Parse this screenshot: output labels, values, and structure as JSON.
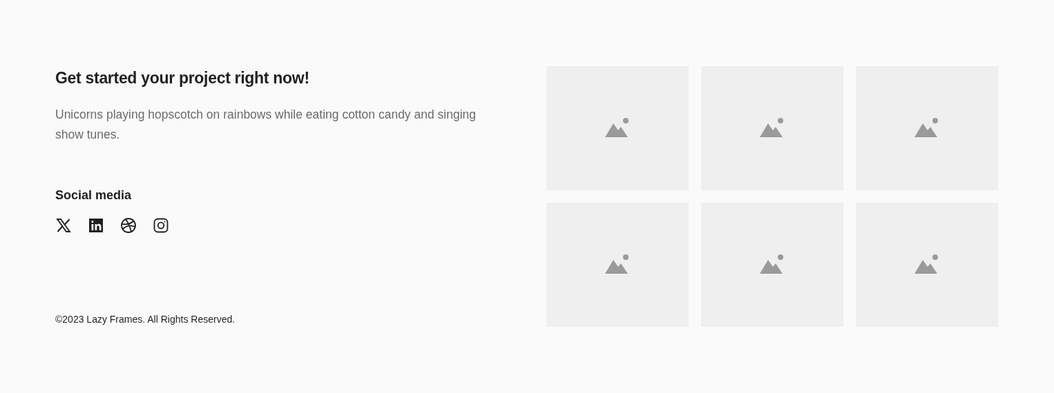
{
  "heading": "Get started your project right now!",
  "description": "Unicorns playing hopscotch on rainbows while eating cotton candy and singing show tunes.",
  "social": {
    "title": "Social media",
    "links": [
      {
        "kind": "x"
      },
      {
        "kind": "linkedin"
      },
      {
        "kind": "dribbble"
      },
      {
        "kind": "instagram"
      }
    ]
  },
  "copyright": "©2023 Lazy Frames. All Rights Reserved.",
  "gallery": [
    {
      "kind": "placeholder"
    },
    {
      "kind": "placeholder"
    },
    {
      "kind": "placeholder"
    },
    {
      "kind": "placeholder"
    },
    {
      "kind": "placeholder"
    },
    {
      "kind": "placeholder"
    }
  ]
}
